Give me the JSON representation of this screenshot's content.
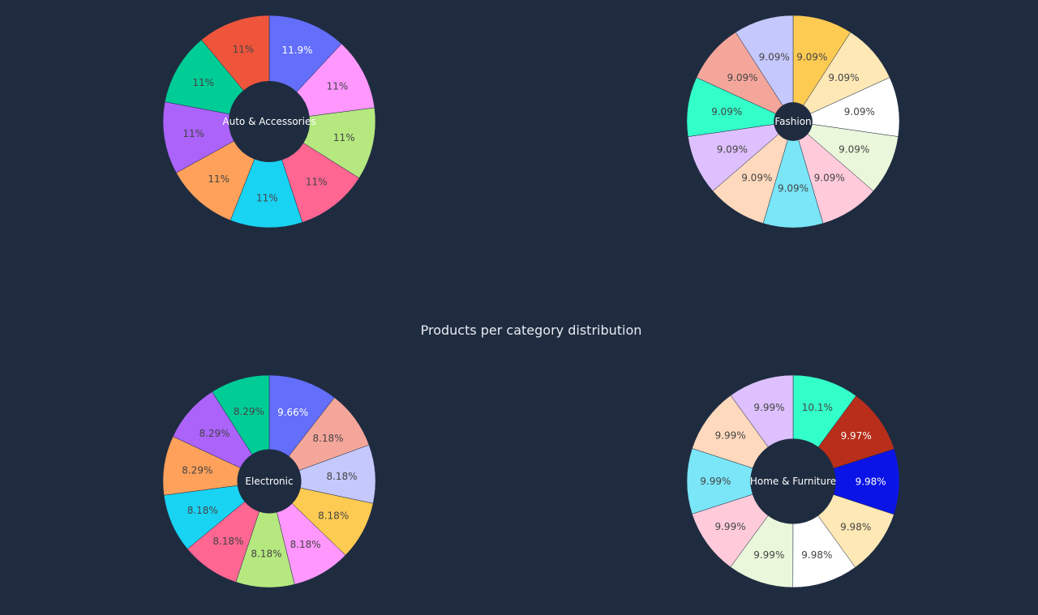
{
  "background": "#1f2c40",
  "chart_data": {
    "type": "pie",
    "title": "Products per category distribution",
    "charts": [
      {
        "name": "Auto & Accessories",
        "hole": 0.38,
        "values": [
          11.9,
          11,
          11,
          11,
          11,
          11,
          11,
          11,
          11
        ],
        "labels": [
          "11.9%",
          "11%",
          "11%",
          "11%",
          "11%",
          "11%",
          "11%",
          "11%",
          "11%"
        ],
        "colors": [
          "#636efa",
          "#ff97ff",
          "#b6e880",
          "#ff6692",
          "#19d3f3",
          "#ffa15a",
          "#ab63fa",
          "#00cc96",
          "#ef553b"
        ],
        "label_colors": [
          "#ffffff",
          "#444444",
          "#444444",
          "#444444",
          "#444444",
          "#444444",
          "#444444",
          "#444444",
          "#444444"
        ]
      },
      {
        "name": "Fashion",
        "hole": 0.18,
        "values": [
          9.09,
          9.09,
          9.09,
          9.09,
          9.09,
          9.09,
          9.09,
          9.09,
          9.09,
          9.09,
          9.09
        ],
        "labels": [
          "9.09%",
          "9.09%",
          "9.09%",
          "9.09%",
          "9.09%",
          "9.09%",
          "9.09%",
          "9.09%",
          "9.09%",
          "9.09%",
          "9.09%"
        ],
        "colors": [
          "#fecb52",
          "#fee8b6",
          "#ffffff",
          "#eaf7da",
          "#ffcbdb",
          "#7ae6f8",
          "#ffd9bd",
          "#ddc0fd",
          "#33ffc9",
          "#f5a69b",
          "#c5c8fd"
        ],
        "label_colors": [
          "#444444",
          "#444444",
          "#444444",
          "#444444",
          "#444444",
          "#444444",
          "#444444",
          "#444444",
          "#444444",
          "#444444",
          "#444444"
        ]
      },
      {
        "name": "Electronic",
        "hole": 0.3,
        "values": [
          9.66,
          8.18,
          8.18,
          8.18,
          8.18,
          8.18,
          8.18,
          8.18,
          8.29,
          8.29,
          8.29
        ],
        "labels": [
          "9.66%",
          "8.18%",
          "8.18%",
          "8.18%",
          "8.18%",
          "8.18%",
          "8.18%",
          "8.18%",
          "8.29%",
          "8.29%",
          "8.29%"
        ],
        "colors": [
          "#636efa",
          "#f5a69b",
          "#c5c8fd",
          "#fecb52",
          "#ff97ff",
          "#b6e880",
          "#ff6692",
          "#19d3f3",
          "#ffa15a",
          "#ab63fa",
          "#00cc96",
          "#ef553b"
        ],
        "label_colors": [
          "#ffffff",
          "#444444",
          "#444444",
          "#444444",
          "#444444",
          "#444444",
          "#444444",
          "#444444",
          "#444444",
          "#444444",
          "#444444",
          "#444444"
        ]
      },
      {
        "name": "Home & Furniture",
        "hole": 0.4,
        "values": [
          10.1,
          9.97,
          9.98,
          9.98,
          9.98,
          9.99,
          9.99,
          9.99,
          9.99,
          9.99
        ],
        "labels": [
          "10.1%",
          "9.97%",
          "9.98%",
          "9.98%",
          "9.98%",
          "9.99%",
          "9.99%",
          "9.99%",
          "9.99%",
          "9.99%"
        ],
        "colors": [
          "#33ffc9",
          "#b82e1a",
          "#0a14e6",
          "#fee8b6",
          "#ffffff",
          "#eaf7da",
          "#ffcbdb",
          "#7ae6f8",
          "#ffd9bd",
          "#ddc0fd"
        ],
        "label_colors": [
          "#444444",
          "#ffffff",
          "#ffffff",
          "#444444",
          "#444444",
          "#444444",
          "#444444",
          "#444444",
          "#444444",
          "#444444"
        ]
      }
    ]
  }
}
